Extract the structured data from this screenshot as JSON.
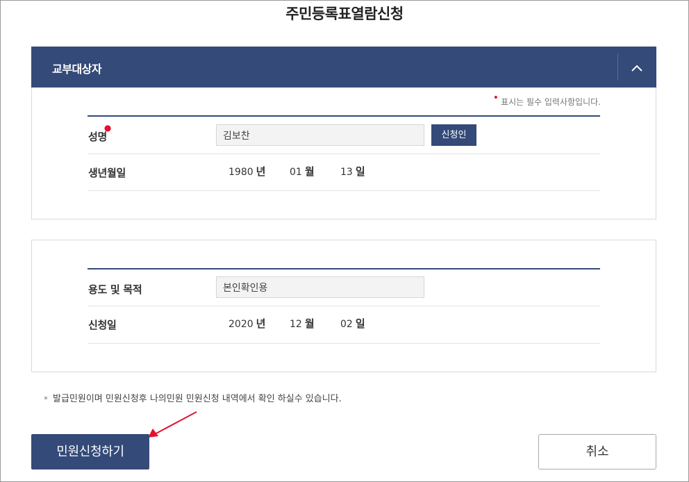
{
  "page": {
    "title": "주민등록표열람신청"
  },
  "recipient_section": {
    "header_title": "교부대상자",
    "required_note": "표시는 필수 입력사항입니다.",
    "name": {
      "label": "성명",
      "value": "김보찬",
      "button_label": "신청인"
    },
    "birth": {
      "label": "생년월일",
      "year": "1980",
      "year_unit": "년",
      "month": "01",
      "month_unit": "월",
      "day": "13",
      "day_unit": "일"
    }
  },
  "purpose_section": {
    "purpose": {
      "label": "용도 및 목적",
      "value": "본인확인용"
    },
    "apply_date": {
      "label": "신청일",
      "year": "2020",
      "year_unit": "년",
      "month": "12",
      "month_unit": "월",
      "day": "02",
      "day_unit": "일"
    }
  },
  "notice": "발급민원이며 민원신청후 나의민원 민원신청 내역에서 확인 하실수 있습니다.",
  "actions": {
    "submit_label": "민원신청하기",
    "cancel_label": "취소"
  },
  "colors": {
    "primary": "#344a78",
    "required": "#e3122d",
    "annotation": "#e3122d"
  },
  "icons": {
    "collapse": "chevron-up-icon",
    "annotation": "red-arrow-icon"
  }
}
